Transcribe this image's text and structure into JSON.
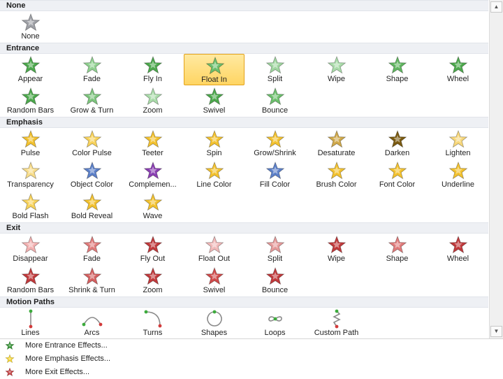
{
  "sections": [
    {
      "title": "None",
      "rows": [
        [
          {
            "label": "None",
            "icon": "star-gray-icon",
            "color": "#9ea0a6"
          }
        ]
      ]
    },
    {
      "title": "Entrance",
      "rows": [
        [
          {
            "label": "Appear",
            "icon": "star-green-icon",
            "color": "#4ca84c"
          },
          {
            "label": "Fade",
            "icon": "star-green-icon",
            "color": "#8fd08f"
          },
          {
            "label": "Fly In",
            "icon": "star-green-icon",
            "color": "#4ca84c"
          },
          {
            "label": "Float In",
            "icon": "star-green-icon",
            "color": "#6cbf6c",
            "selected": true
          },
          {
            "label": "Split",
            "icon": "star-green-icon",
            "color": "#9fd59f"
          },
          {
            "label": "Wipe",
            "icon": "star-green-icon",
            "color": "#a9dba9"
          },
          {
            "label": "Shape",
            "icon": "star-green-icon",
            "color": "#5fb55f"
          },
          {
            "label": "Wheel",
            "icon": "star-green-icon",
            "color": "#4ca84c"
          }
        ],
        [
          {
            "label": "Random Bars",
            "icon": "star-green-icon",
            "color": "#4ca84c"
          },
          {
            "label": "Grow & Turn",
            "icon": "star-green-icon",
            "color": "#7cc47c"
          },
          {
            "label": "Zoom",
            "icon": "star-green-icon",
            "color": "#a9dba9"
          },
          {
            "label": "Swivel",
            "icon": "star-green-icon",
            "color": "#4ca84c"
          },
          {
            "label": "Bounce",
            "icon": "star-green-icon",
            "color": "#6cbf6c"
          }
        ]
      ]
    },
    {
      "title": "Emphasis",
      "rows": [
        [
          {
            "label": "Pulse",
            "icon": "star-gold-icon",
            "color": "#f2c12e"
          },
          {
            "label": "Color Pulse",
            "icon": "star-gold-icon",
            "color": "#f7d25a"
          },
          {
            "label": "Teeter",
            "icon": "star-gold-icon",
            "color": "#f2c12e"
          },
          {
            "label": "Spin",
            "icon": "star-gold-icon",
            "color": "#f2c12e"
          },
          {
            "label": "Grow/Shrink",
            "icon": "star-gold-icon",
            "color": "#f2c12e"
          },
          {
            "label": "Desaturate",
            "icon": "star-gold-icon",
            "color": "#cfa84a"
          },
          {
            "label": "Darken",
            "icon": "star-gold-icon",
            "color": "#7a5a10"
          },
          {
            "label": "Lighten",
            "icon": "star-gold-icon",
            "color": "#f7d77a"
          }
        ],
        [
          {
            "label": "Transparency",
            "icon": "star-gold-icon",
            "color": "#f7dc8a"
          },
          {
            "label": "Object Color",
            "icon": "star-gold-icon",
            "color": "#5b7fc8"
          },
          {
            "label": "Complemen...",
            "icon": "star-gold-icon",
            "color": "#8a3fb2"
          },
          {
            "label": "Line Color",
            "icon": "star-gold-icon",
            "color": "#f2c12e"
          },
          {
            "label": "Fill Color",
            "icon": "star-gold-icon",
            "color": "#5b7fc8"
          },
          {
            "label": "Brush Color",
            "icon": "star-gold-icon",
            "color": "#f2c12e"
          },
          {
            "label": "Font Color",
            "icon": "star-gold-icon",
            "color": "#f2c12e"
          },
          {
            "label": "Underline",
            "icon": "star-gold-icon",
            "color": "#f2c12e"
          }
        ],
        [
          {
            "label": "Bold Flash",
            "icon": "star-gold-icon",
            "color": "#f7d25a"
          },
          {
            "label": "Bold Reveal",
            "icon": "star-gold-icon",
            "color": "#f2c12e"
          },
          {
            "label": "Wave",
            "icon": "star-gold-icon",
            "color": "#f2c12e"
          }
        ]
      ]
    },
    {
      "title": "Exit",
      "rows": [
        [
          {
            "label": "Disappear",
            "icon": "star-red-icon",
            "color": "#f2b0b0"
          },
          {
            "label": "Fade",
            "icon": "star-red-icon",
            "color": "#e07a7a"
          },
          {
            "label": "Fly Out",
            "icon": "star-red-icon",
            "color": "#c0393b"
          },
          {
            "label": "Float Out",
            "icon": "star-red-icon",
            "color": "#f0b8b8"
          },
          {
            "label": "Split",
            "icon": "star-red-icon",
            "color": "#e59a9a"
          },
          {
            "label": "Wipe",
            "icon": "star-red-icon",
            "color": "#c0393b"
          },
          {
            "label": "Shape",
            "icon": "star-red-icon",
            "color": "#e07a7a"
          },
          {
            "label": "Wheel",
            "icon": "star-red-icon",
            "color": "#c0393b"
          }
        ],
        [
          {
            "label": "Random Bars",
            "icon": "star-red-icon",
            "color": "#c0393b"
          },
          {
            "label": "Shrink & Turn",
            "icon": "star-red-icon",
            "color": "#d46060"
          },
          {
            "label": "Zoom",
            "icon": "star-red-icon",
            "color": "#c0393b"
          },
          {
            "label": "Swivel",
            "icon": "star-red-icon",
            "color": "#d04a4a"
          },
          {
            "label": "Bounce",
            "icon": "star-red-icon",
            "color": "#c0393b"
          }
        ]
      ]
    },
    {
      "title": "Motion Paths",
      "rows": [
        [
          {
            "label": "Lines",
            "icon": "path-lines-icon",
            "color": "#4ca84c"
          },
          {
            "label": "Arcs",
            "icon": "path-arcs-icon",
            "color": "#4ca84c"
          },
          {
            "label": "Turns",
            "icon": "path-turns-icon",
            "color": "#4ca84c"
          },
          {
            "label": "Shapes",
            "icon": "path-shapes-icon",
            "color": "#4ca84c"
          },
          {
            "label": "Loops",
            "icon": "path-loops-icon",
            "color": "#4ca84c"
          },
          {
            "label": "Custom Path",
            "icon": "path-custom-icon",
            "color": "#4ca84c"
          }
        ]
      ]
    }
  ],
  "more": [
    {
      "label": "More Entrance Effects...",
      "icon": "star-green-icon",
      "color": "#2f8f2f"
    },
    {
      "label": "More Emphasis Effects...",
      "icon": "star-gold-icon",
      "color": "#f2d22e"
    },
    {
      "label": "More Exit Effects...",
      "icon": "star-red-icon",
      "color": "#c0393b"
    }
  ]
}
